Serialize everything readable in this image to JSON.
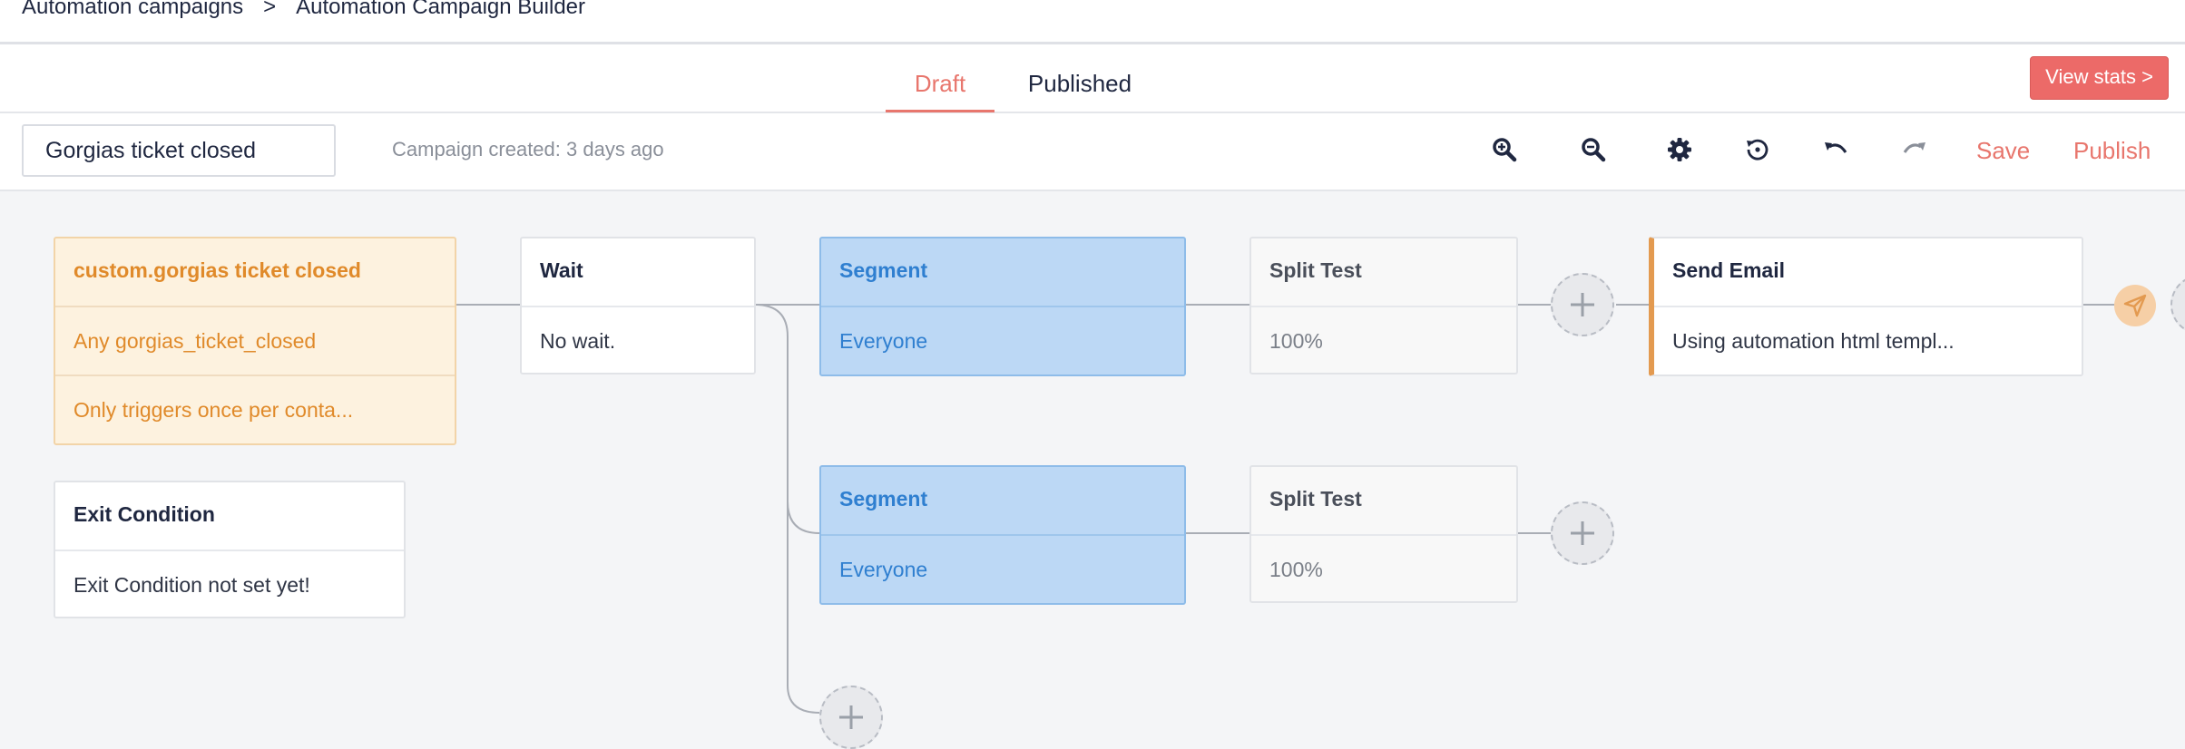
{
  "breadcrumb": {
    "item1": "Automation campaigns",
    "separator": ">",
    "item2": "Automation Campaign Builder"
  },
  "tabs": {
    "draft": "Draft",
    "published": "Published",
    "active": "Draft"
  },
  "view_stats_label": "View stats >",
  "toolbar": {
    "campaign_name": "Gorgias ticket closed",
    "created_text": "Campaign created: 3 days ago",
    "icons": [
      "zoom-in-icon",
      "zoom-out-icon",
      "gear-icon",
      "history-icon",
      "undo-icon",
      "redo-icon"
    ],
    "save_label": "Save",
    "publish_label": "Publish"
  },
  "nodes": {
    "trigger": {
      "title": "custom.gorgias ticket closed",
      "event": "Any gorgias_ticket_closed",
      "frequency": "Only triggers once per conta..."
    },
    "exit": {
      "title": "Exit Condition",
      "body": "Exit Condition not set yet!"
    },
    "wait": {
      "title": "Wait",
      "body": "No wait."
    },
    "segment1": {
      "title": "Segment",
      "body": "Everyone"
    },
    "segment2": {
      "title": "Segment",
      "body": "Everyone"
    },
    "split1": {
      "title": "Split Test",
      "body": "100%"
    },
    "split2": {
      "title": "Split Test",
      "body": "100%"
    },
    "email": {
      "title": "Send Email",
      "body": "Using automation html templ..."
    }
  },
  "colors": {
    "accent": "#e8766d",
    "trigger_text": "#e08a2a",
    "segment_bg": "#bcd8f5",
    "segment_text": "#2f7fd0",
    "email_bar": "#e39a50"
  }
}
